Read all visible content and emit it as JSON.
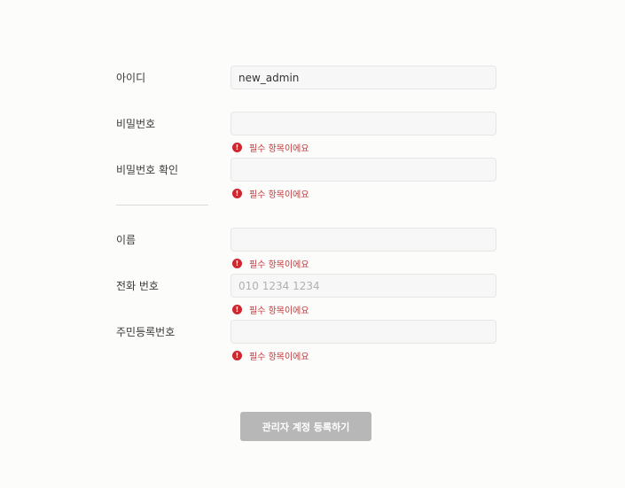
{
  "form": {
    "fields": [
      {
        "label": "아이디",
        "value": "new_admin",
        "placeholder": "",
        "error": ""
      },
      {
        "label": "비밀번호",
        "value": "",
        "placeholder": "",
        "error": "필수 항목이에요"
      },
      {
        "label": "비밀번호 확인",
        "value": "",
        "placeholder": "",
        "error": "필수 항목이에요"
      },
      {
        "label": "이름",
        "value": "",
        "placeholder": "",
        "error": "필수 항목이에요"
      },
      {
        "label": "전화 번호",
        "value": "",
        "placeholder": "010 1234 1234",
        "error": "필수 항목이에요"
      },
      {
        "label": "주민등록번호",
        "value": "",
        "placeholder": "",
        "error": "필수 항목이에요"
      }
    ],
    "error_icon_glyph": "!",
    "submit_label": "관리자 계정 등록하기"
  },
  "colors": {
    "error": "#d0262d",
    "submit_disabled": "#b7b7b7",
    "field_background": "#f7f7f7"
  },
  "icons": {
    "error": "alert-circle-icon"
  }
}
